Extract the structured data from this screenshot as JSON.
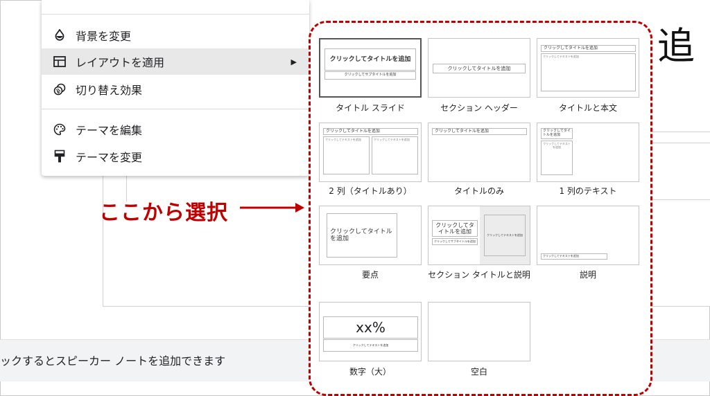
{
  "menu": {
    "items": [
      {
        "label": "背景を変更",
        "icon": "droplet-icon"
      },
      {
        "label": "レイアウトを適用",
        "icon": "layout-icon",
        "submenu_arrow": "▶"
      },
      {
        "label": "切り替え効果",
        "icon": "transition-icon"
      },
      {
        "label": "テーマを編集",
        "icon": "palette-icon"
      },
      {
        "label": "テーマを変更",
        "icon": "paint-roller-icon"
      }
    ]
  },
  "layouts": {
    "captions": [
      "タイトル スライド",
      "セクション ヘッダー",
      "タイトルと本文",
      "2 列（タイトルあり）",
      "タイトルのみ",
      "1 列のテキスト",
      "要点",
      "セクション タイトルと説明",
      "説明",
      "数字（大）",
      "空白"
    ],
    "thumb_text": {
      "title_click": "クリックしてタイトルを追加",
      "subtitle_click": "クリックしてサブタイトルを追加",
      "text_click": "クリックしてテキストを追加",
      "title_click_wrap1": "クリックしてタイトルを追加",
      "title_click_wrap2": "クリックしてタイトル",
      "title_click_wrap3": "を追加",
      "section_title_a": "クリックしてタ",
      "section_title_b": "イトルを追加",
      "one_col_title_a": "クリックしてタイ",
      "one_col_title_b": "トルを追加",
      "big_number": "xx%"
    }
  },
  "callout": {
    "text": "ここから選択"
  },
  "slide": {
    "partial_char": "追"
  },
  "notes": {
    "text": "ックするとスピーカー ノートを追加できます"
  },
  "colors": {
    "accent_red": "#c00000",
    "menu_highlight": "#e8e8e8"
  }
}
